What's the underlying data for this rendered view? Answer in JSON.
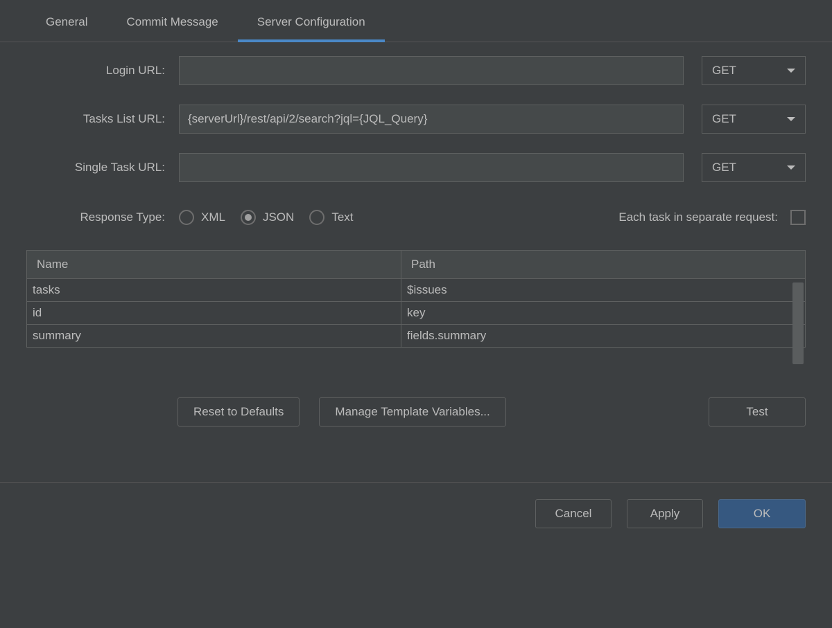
{
  "tabs": {
    "general": "General",
    "commit_message": "Commit Message",
    "server_configuration": "Server Configuration"
  },
  "form": {
    "login_url_label": "Login URL:",
    "login_url_value": "",
    "login_url_method": "GET",
    "tasks_list_url_label": "Tasks List URL:",
    "tasks_list_url_value": "{serverUrl}/rest/api/2/search?jql={JQL_Query}",
    "tasks_list_url_method": "GET",
    "single_task_url_label": "Single Task URL:",
    "single_task_url_value": "",
    "single_task_url_method": "GET",
    "response_type_label": "Response Type:",
    "response_type_xml": "XML",
    "response_type_json": "JSON",
    "response_type_text": "Text",
    "each_task_separate_label": "Each task in separate request:"
  },
  "table": {
    "header_name": "Name",
    "header_path": "Path",
    "rows": [
      {
        "name": "tasks",
        "path": "$issues"
      },
      {
        "name": "id",
        "path": "key"
      },
      {
        "name": "summary",
        "path": "fields.summary"
      }
    ]
  },
  "buttons": {
    "reset_defaults": "Reset to Defaults",
    "manage_template_vars": "Manage Template Variables...",
    "test": "Test",
    "cancel": "Cancel",
    "apply": "Apply",
    "ok": "OK"
  }
}
